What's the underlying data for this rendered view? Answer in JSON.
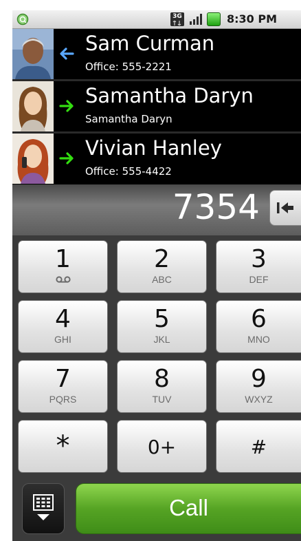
{
  "status_bar": {
    "time": "8:30 PM",
    "network_label": "3G",
    "icons": [
      "notification-icon",
      "3g-icon",
      "signal-icon",
      "battery-icon"
    ]
  },
  "contacts": [
    {
      "name": "Sam Curman",
      "detail": "Office: 555-2221",
      "call_type": "incoming",
      "arrow_color": "#5aa8ff"
    },
    {
      "name": "Samantha Daryn",
      "detail": "Samantha Daryn",
      "call_type": "outgoing",
      "arrow_color": "#33dd11"
    },
    {
      "name": "Vivian Hanley",
      "detail": "Office: 555-4422",
      "call_type": "outgoing",
      "arrow_color": "#33dd11"
    }
  ],
  "dialer": {
    "digits": "7354",
    "keys": [
      {
        "digit": "1",
        "letters": "",
        "icon": "voicemail-icon"
      },
      {
        "digit": "2",
        "letters": "ABC"
      },
      {
        "digit": "3",
        "letters": "DEF"
      },
      {
        "digit": "4",
        "letters": "GHI"
      },
      {
        "digit": "5",
        "letters": "JKL"
      },
      {
        "digit": "6",
        "letters": "MNO"
      },
      {
        "digit": "7",
        "letters": "PQRS"
      },
      {
        "digit": "8",
        "letters": "TUV"
      },
      {
        "digit": "9",
        "letters": "WXYZ"
      },
      {
        "digit": "*",
        "letters": ""
      },
      {
        "digit": "0+",
        "letters": ""
      },
      {
        "digit": "#",
        "letters": ""
      }
    ]
  },
  "actions": {
    "call_label": "Call",
    "dialpad_icon": "dialpad-toggle-icon"
  },
  "colors": {
    "call_green": "#56a424",
    "key_background": "#e2e2e2",
    "list_background": "#000000"
  }
}
